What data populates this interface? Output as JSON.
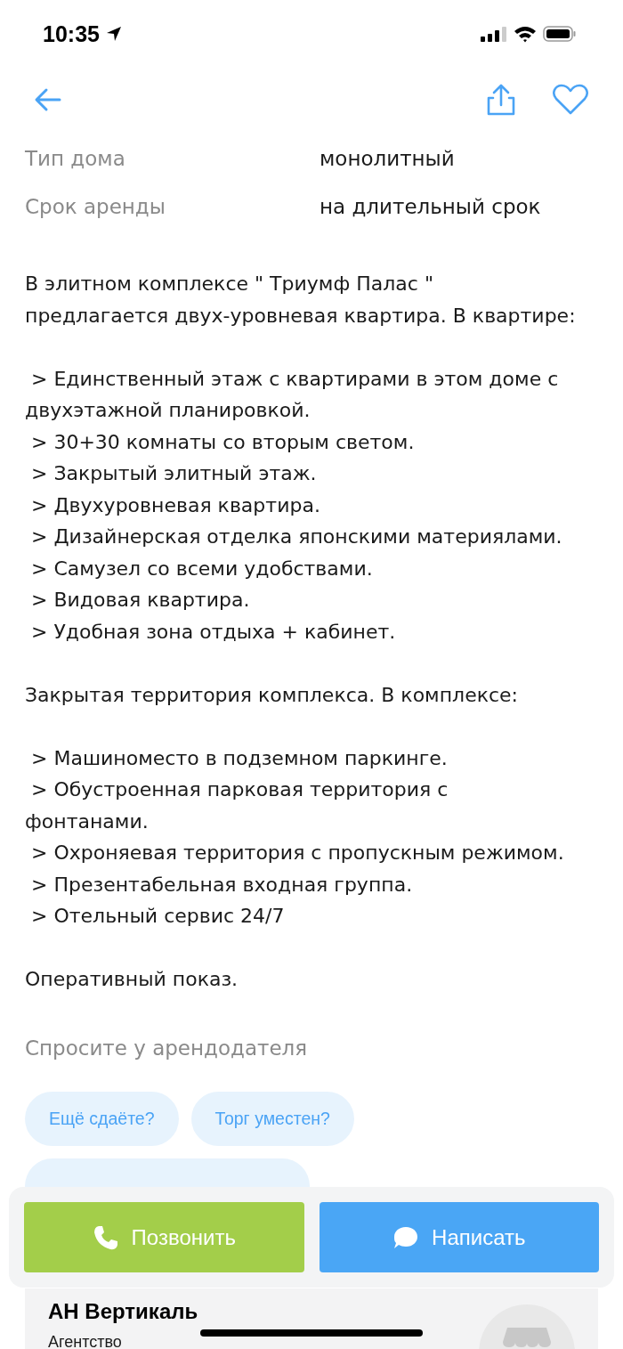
{
  "status_bar": {
    "time": "10:35"
  },
  "params": [
    {
      "label": "Тип дома",
      "value": "монолитный"
    },
    {
      "label": "Срок аренды",
      "value": "на длительный срок"
    }
  ],
  "description": [
    [
      "В элитном комплексе \" Триумф Палас \"\nпредлагается двух-уровневая квартира. В квартире:"
    ],
    [
      " > Единственный этаж с квартирами в этом доме с\nдвухэтажной планировкой.",
      " > 30+30 комнаты со вторым светом.",
      " > Закрытый элитный этаж.",
      " > Двухуровневая квартира.",
      " > Дизайнерская отделка японскими материялами.",
      " > Самузел со всеми удобствами.",
      " > Видовая квартира.",
      " > Удобная зона отдыха + кабинет."
    ],
    [
      "Закрытая территория комплекса. В комплексе:"
    ],
    [
      " > Машиноместо в подземном паркинге.",
      " > Обустроенная парковая территория с\nфонтанами.",
      " > Охроняевая территория с пропускным режимом.",
      " > Презентабельная входная группа.",
      " > Отельный сервис 24/7"
    ],
    [
      "Оперативный показ."
    ]
  ],
  "ask": {
    "title": "Спросите у арендодателя",
    "chips": [
      {
        "kind": "full",
        "label": "Ещё сдаёте?"
      },
      {
        "kind": "full",
        "label": "Торг уместен?"
      },
      {
        "kind": "cut"
      }
    ]
  },
  "actions": [
    {
      "kind": "call",
      "label": "Позвонить"
    },
    {
      "kind": "message",
      "label": "Написать"
    }
  ],
  "agency": {
    "name": "АН Вертикаль",
    "type": "Агентство"
  }
}
